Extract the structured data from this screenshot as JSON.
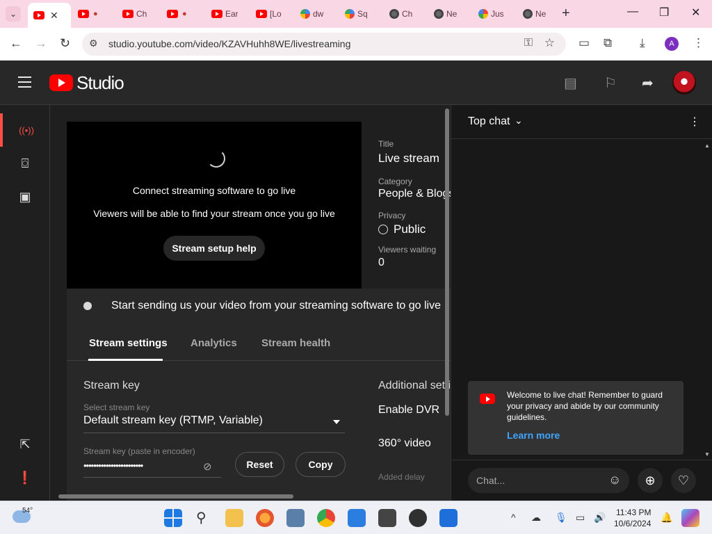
{
  "browser": {
    "tabs": [
      {
        "label": "",
        "icon": "youtube-icon",
        "active": true
      },
      {
        "label": "",
        "icon": "youtube-icon",
        "badge": "red-dot"
      },
      {
        "label": "Ch",
        "icon": "youtube-icon"
      },
      {
        "label": "",
        "icon": "youtube-icon",
        "badge": "red-dot"
      },
      {
        "label": "Ear",
        "icon": "youtube-icon"
      },
      {
        "label": "[Lo",
        "icon": "youtube-icon"
      },
      {
        "label": "dw",
        "icon": "pinwheel-icon"
      },
      {
        "label": "Sq",
        "icon": "pinwheel-icon"
      },
      {
        "label": "Ch",
        "icon": "chatgpt-icon"
      },
      {
        "label": "Ne",
        "icon": "globe-icon"
      },
      {
        "label": "Jus",
        "icon": "google-icon"
      },
      {
        "label": "Ne",
        "icon": "globe-icon"
      }
    ],
    "url": "studio.youtube.com/video/KZAVHuhh8WE/livestreaming",
    "profile_initial": "A"
  },
  "studio": {
    "logo_text": "Studio"
  },
  "preview": {
    "connect_text": "Connect streaming software to go live",
    "viewers_text": "Viewers will be able to find your stream once you go live",
    "help_button": "Stream setup help"
  },
  "meta": {
    "title_label": "Title",
    "title_value": "Live stream",
    "category_label": "Category",
    "category_value": "People & Blogs",
    "privacy_label": "Privacy",
    "privacy_value": "Public",
    "viewers_label": "Viewers waiting",
    "viewers_value": "0"
  },
  "status": {
    "text": "Start sending us your video from your streaming software to go live"
  },
  "settings": {
    "tabs": [
      "Stream settings",
      "Analytics",
      "Stream health"
    ],
    "stream_key_heading": "Stream key",
    "select_key_label": "Select stream key",
    "select_key_value": "Default stream key (RTMP, Variable)",
    "key_label": "Stream key (paste in encoder)",
    "key_value": "••••••••••••••••••••••••",
    "reset_button": "Reset",
    "copy_button": "Copy",
    "additional_heading": "Additional settings",
    "enable_dvr": "Enable DVR",
    "video_360": "360° video",
    "added_delay": "Added delay"
  },
  "chat": {
    "mode": "Top chat",
    "welcome_text": "Welcome to live chat! Remember to guard your privacy and abide by our community guidelines.",
    "learn_more": "Learn more",
    "input_placeholder": "Chat..."
  },
  "taskbar": {
    "weather_temp": "54°",
    "time": "11:43 PM",
    "date": "10/6/2024"
  }
}
